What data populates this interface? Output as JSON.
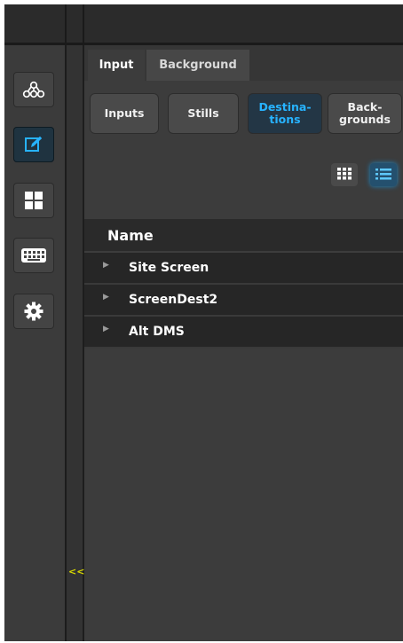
{
  "sidebar": {
    "items": [
      {
        "name": "topology-icon"
      },
      {
        "name": "edit-icon",
        "active": true
      },
      {
        "name": "grid-icon"
      },
      {
        "name": "keyboard-icon"
      },
      {
        "name": "gear-icon"
      }
    ],
    "collapse_label": "<<"
  },
  "tabs": [
    {
      "label": "Input",
      "active": true
    },
    {
      "label": "Background",
      "active": false
    }
  ],
  "filters": [
    {
      "label": "Inputs",
      "selected": false
    },
    {
      "label": "Stills",
      "selected": false
    },
    {
      "label": "Destina-\ntions",
      "selected": true
    },
    {
      "label": "Back-\ngrounds",
      "selected": false
    }
  ],
  "view_toggle": {
    "options": [
      {
        "name": "grid-view-icon",
        "active": false
      },
      {
        "name": "list-view-icon",
        "active": true
      }
    ]
  },
  "table": {
    "header": "Name",
    "rows": [
      {
        "name": "Site Screen"
      },
      {
        "name": "ScreenDest2"
      },
      {
        "name": "Alt DMS"
      }
    ]
  },
  "colors": {
    "accent": "#27b3ff",
    "collapse": "#d8d800"
  }
}
